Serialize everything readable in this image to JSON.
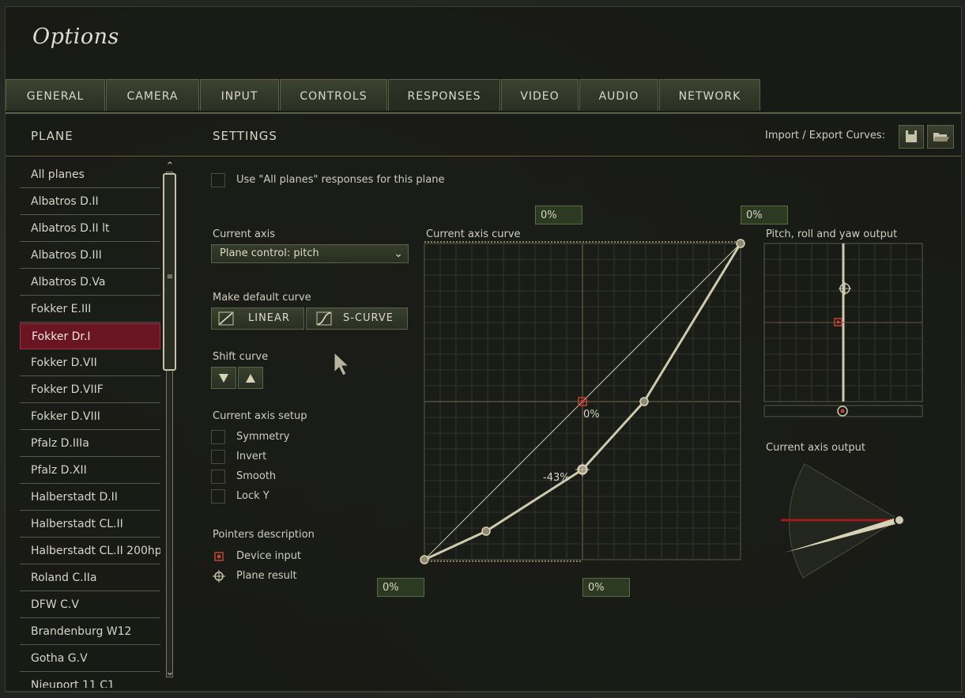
{
  "window": {
    "title": "Options"
  },
  "tabs": [
    {
      "label": "GENERAL"
    },
    {
      "label": "CAMERA"
    },
    {
      "label": "INPUT"
    },
    {
      "label": "CONTROLS"
    },
    {
      "label": "RESPONSES"
    },
    {
      "label": "VIDEO"
    },
    {
      "label": "AUDIO"
    },
    {
      "label": "NETWORK"
    }
  ],
  "active_tab": "RESPONSES",
  "plane_header": "PLANE",
  "settings_header": "SETTINGS",
  "import_export_label": "Import / Export Curves:",
  "icons": {
    "save": "save-icon",
    "open": "folder-icon"
  },
  "planes": [
    "All planes",
    "Albatros D.II",
    "Albatros D.II lt",
    "Albatros D.III",
    "Albatros D.Va",
    "Fokker E.III",
    "Fokker Dr.I",
    "Fokker D.VII",
    "Fokker D.VIIF",
    "Fokker D.VIII",
    "Pfalz D.IIIa",
    "Pfalz D.XII",
    "Halberstadt D.II",
    "Halberstadt CL.II",
    "Halberstadt CL.II 200hp",
    "Roland C.IIa",
    "DFW C.V",
    "Brandenburg W12",
    "Gotha G.V",
    "Nieuport 11 C1"
  ],
  "selected_plane": "Fokker Dr.I",
  "use_all_planes_label": "Use \"All planes\" responses for this plane",
  "current_axis_label": "Current axis",
  "current_axis_value": "Plane control: pitch",
  "default_curve_label": "Make default curve",
  "linear_label": "LINEAR",
  "scurve_label": "S-CURVE",
  "shift_curve_label": "Shift curve",
  "axis_setup_label": "Current axis setup",
  "setup_options": [
    {
      "label": "Symmetry",
      "checked": false
    },
    {
      "label": "Invert",
      "checked": false
    },
    {
      "label": "Smooth",
      "checked": false
    },
    {
      "label": "Lock Y",
      "checked": false
    }
  ],
  "pointers_label": "Pointers description",
  "pointers": [
    {
      "label": "Device input",
      "icon": "device-input-icon",
      "color": "#c0443a"
    },
    {
      "label": "Plane result",
      "icon": "plane-result-icon",
      "color": "#cfc9ae"
    }
  ],
  "curve_panel": {
    "title": "Current axis curve",
    "top_left_value": "0%",
    "top_right_value": "0%",
    "bottom_left_value": "0%",
    "bottom_center_value": "0%",
    "center_value": "0%",
    "result_value": "-43%"
  },
  "chart_data": {
    "type": "line",
    "title": "Current axis curve",
    "xlim": [
      -100,
      100
    ],
    "ylim": [
      -100,
      100
    ],
    "grid": true,
    "series": [
      {
        "x": [
          -100,
          -61,
          0,
          39,
          100
        ],
        "y": [
          -100,
          -82,
          -43,
          0,
          100
        ]
      }
    ],
    "reference_line": {
      "x": [
        -100,
        100
      ],
      "y": [
        -100,
        100
      ]
    },
    "device_input": {
      "x": 0,
      "y": 0
    },
    "plane_result": {
      "x": 0,
      "y": -43
    }
  },
  "pry_panel": {
    "title": "Pitch, roll and yaw output"
  },
  "axis_output_panel": {
    "title": "Current axis output"
  },
  "colors": {
    "accent": "#6a1622",
    "curve": "#cfc9ae",
    "tab": "#3c4330",
    "value_box": "#2c3a22"
  }
}
